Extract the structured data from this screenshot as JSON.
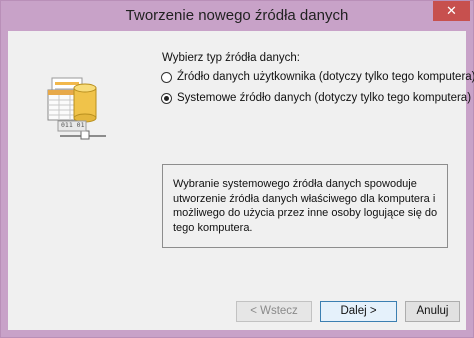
{
  "window": {
    "title": "Tworzenie nowego źródła danych",
    "close_glyph": "✕"
  },
  "icon": {
    "name": "data-source-icon",
    "badge_text": "011 01"
  },
  "prompt": "Wybierz typ źródła danych:",
  "options": [
    {
      "label": "Źródło danych użytkownika (dotyczy tylko tego komputera)",
      "selected": false
    },
    {
      "label": "Systemowe źródło danych (dotyczy tylko tego komputera)",
      "selected": true
    }
  ],
  "info": {
    "text": "Wybranie systemowego źródła danych spowoduje utworzenie źródła danych właściwego dla komputera i możliwego do użycia przez inne osoby logujące się do tego komputera."
  },
  "buttons": {
    "back": "< Wstecz",
    "next": "Dalej >",
    "cancel": "Anuluj"
  },
  "colors": {
    "title_bar": "#c8a2c8",
    "close_button": "#c7504e",
    "client_bg": "#f0f0f0",
    "default_button_border": "#3c7fb1"
  }
}
